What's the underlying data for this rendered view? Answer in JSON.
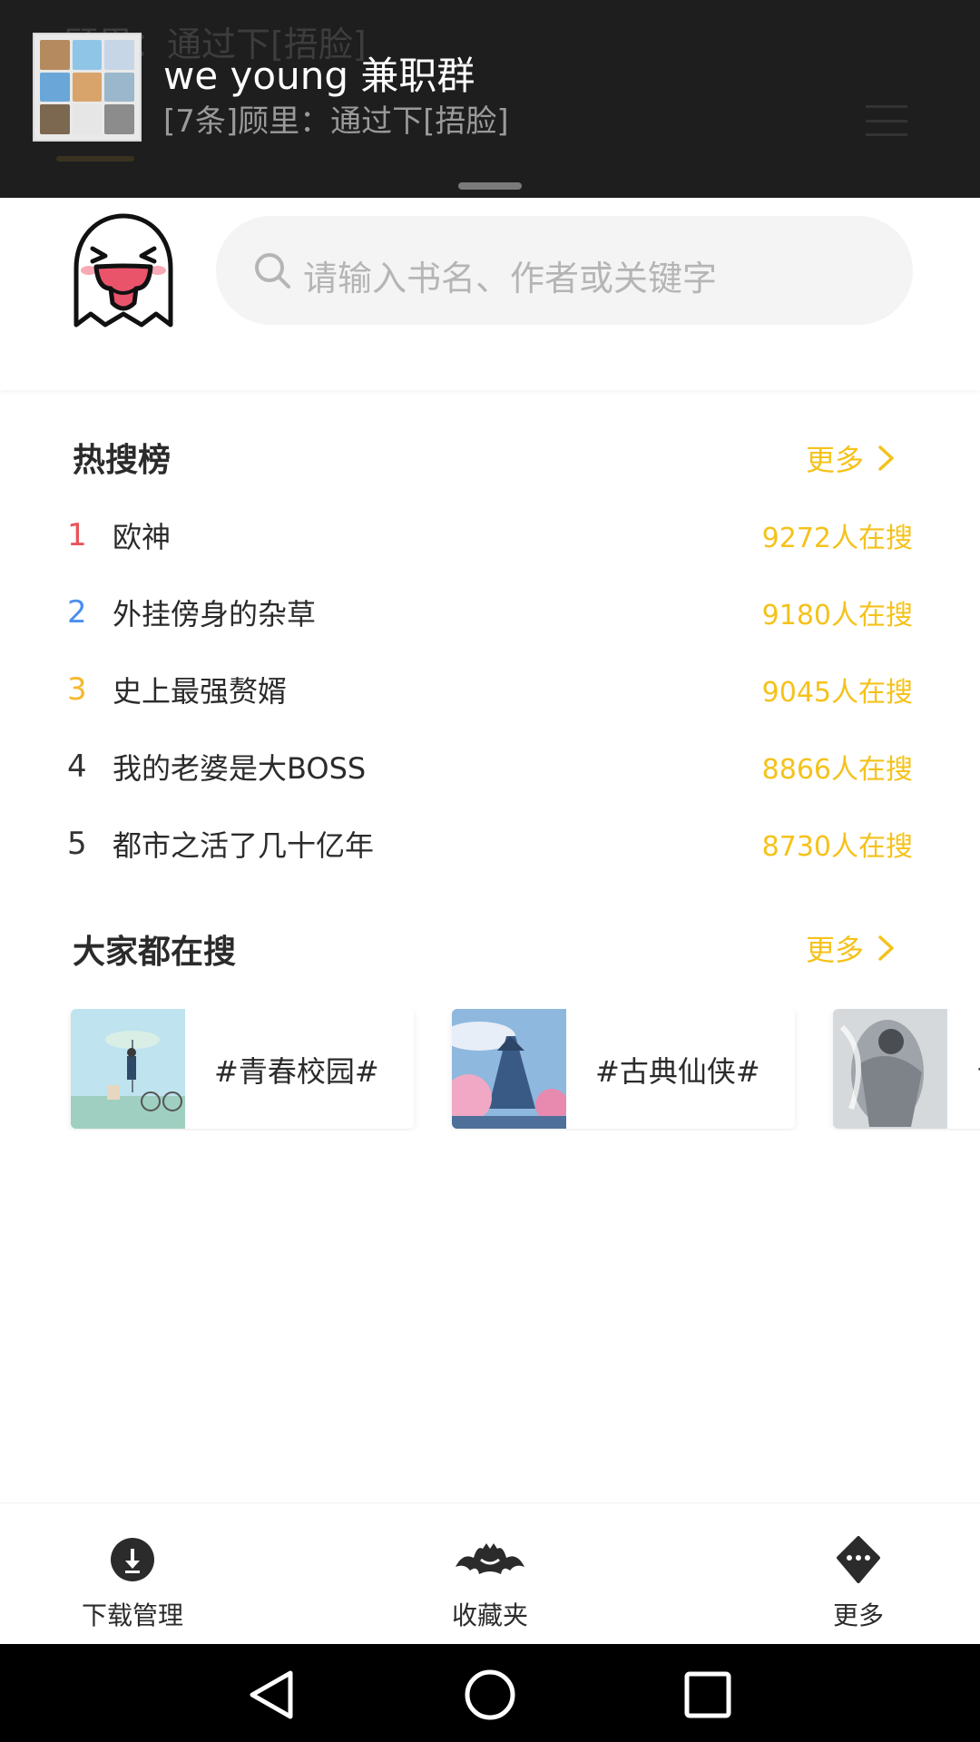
{
  "notification": {
    "behind_text": "顾里：通过下[捂脸]",
    "title": "we young 兼职群",
    "message": "[7条]顾里：通过下[捂脸]"
  },
  "search": {
    "placeholder": "请输入书名、作者或关键字"
  },
  "hot_list": {
    "title": "热搜榜",
    "more": "更多",
    "items": [
      {
        "rank": "1",
        "name": "欧神",
        "count": "9272人在搜",
        "rank_color": "#e8545a"
      },
      {
        "rank": "2",
        "name": "外挂傍身的杂草",
        "count": "9180人在搜",
        "rank_color": "#4a8ff0"
      },
      {
        "rank": "3",
        "name": "史上最强赘婿",
        "count": "9045人在搜",
        "rank_color": "#f5b82e"
      },
      {
        "rank": "4",
        "name": "我的老婆是大BOSS",
        "count": "8866人在搜",
        "rank_color": "#333333"
      },
      {
        "rank": "5",
        "name": "都市之活了几十亿年",
        "count": "8730人在搜",
        "rank_color": "#333333"
      }
    ]
  },
  "popular": {
    "title": "大家都在搜",
    "more": "更多",
    "tags": [
      {
        "label": "#青春校园#"
      },
      {
        "label": "#古典仙侠#"
      },
      {
        "label": "#"
      }
    ]
  },
  "bottom_bar": {
    "items": [
      {
        "label": "下载管理",
        "icon": "download-icon"
      },
      {
        "label": "收藏夹",
        "icon": "bat-icon"
      },
      {
        "label": "更多",
        "icon": "more-icon"
      }
    ]
  },
  "colors": {
    "accent": "#f5c21b",
    "notification_bg": "#1e1e1e"
  }
}
